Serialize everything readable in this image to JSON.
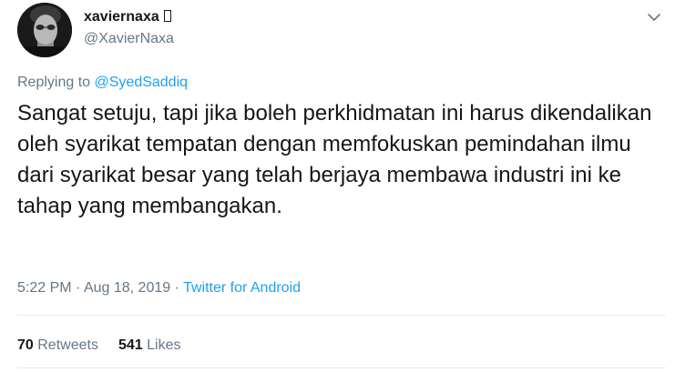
{
  "author": {
    "display_name": "xaviernaxa",
    "handle": "@XavierNaxa"
  },
  "reply": {
    "prefix": "Replying to",
    "mention": "@SyedSaddiq"
  },
  "tweet": {
    "text": "Sangat setuju, tapi jika boleh perkhidmatan ini harus dikendalikan oleh syarikat tempatan dengan memfokuskan pemindahan ilmu dari syarikat besar yang telah berjaya membawa industri ini ke tahap yang membangakan."
  },
  "meta": {
    "time": "5:22 PM",
    "separator": "·",
    "date": "Aug 18, 2019",
    "source": "Twitter for Android"
  },
  "stats": {
    "retweets_count": "70",
    "retweets_label": "Retweets",
    "likes_count": "541",
    "likes_label": "Likes"
  },
  "icons": {
    "more": "chevron-down-icon",
    "avatar": "profile-photo"
  },
  "colors": {
    "link": "#1da1f2",
    "secondary_text": "#657786",
    "primary_text": "#14171a",
    "divider": "#e6ecf0"
  }
}
